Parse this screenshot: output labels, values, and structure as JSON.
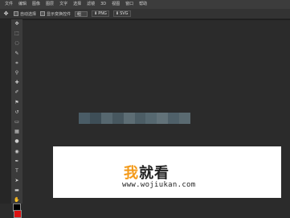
{
  "menu": {
    "items": [
      "文件",
      "编辑",
      "图像",
      "图层",
      "文字",
      "选择",
      "滤镜",
      "3D",
      "视图",
      "窗口",
      "帮助"
    ]
  },
  "options_bar": {
    "tool_icon": "move-tool-icon",
    "auto_select_label": "自动选择",
    "show_transform_label": "显示变换控件",
    "dropdown_value": "组",
    "btn_png_label": "PNG",
    "btn_svg_label": "SVG"
  },
  "toolbox": {
    "tools": [
      {
        "name": "move-tool-icon",
        "glyph": "✥"
      },
      {
        "name": "marquee-tool-icon",
        "glyph": "⬚"
      },
      {
        "name": "lasso-tool-icon",
        "glyph": "◌"
      },
      {
        "name": "quick-select-tool-icon",
        "glyph": "✎"
      },
      {
        "name": "crop-tool-icon",
        "glyph": "⌗"
      },
      {
        "name": "eyedropper-tool-icon",
        "glyph": "⚲"
      },
      {
        "name": "healing-tool-icon",
        "glyph": "✚"
      },
      {
        "name": "brush-tool-icon",
        "glyph": "✐"
      },
      {
        "name": "stamp-tool-icon",
        "glyph": "⚑"
      },
      {
        "name": "history-brush-tool-icon",
        "glyph": "↺"
      },
      {
        "name": "eraser-tool-icon",
        "glyph": "▭"
      },
      {
        "name": "gradient-tool-icon",
        "glyph": "▦"
      },
      {
        "name": "blur-tool-icon",
        "glyph": "●"
      },
      {
        "name": "dodge-tool-icon",
        "glyph": "◉"
      },
      {
        "name": "pen-tool-icon",
        "glyph": "✒"
      },
      {
        "name": "type-tool-icon",
        "glyph": "T"
      },
      {
        "name": "path-select-tool-icon",
        "glyph": "➤"
      },
      {
        "name": "shape-tool-icon",
        "glyph": "▬"
      },
      {
        "name": "hand-tool-icon",
        "glyph": "✋"
      },
      {
        "name": "zoom-tool-icon",
        "glyph": "⚲"
      }
    ],
    "foreground_color": "#000000",
    "background_color": "#dd1111"
  },
  "watermark": {
    "char1": "我",
    "rest": "就看",
    "url": "www.wojiukan.com"
  },
  "colors": {
    "accent": "#f39a1a",
    "canvas_bg": "#2b2b2b",
    "blur_strip": [
      "#4a5c66",
      "#3e4e57",
      "#56676f",
      "#47575f",
      "#5d6d74",
      "#4c5d65",
      "#566870",
      "#627279",
      "#4f6069",
      "#5a6a71"
    ]
  }
}
